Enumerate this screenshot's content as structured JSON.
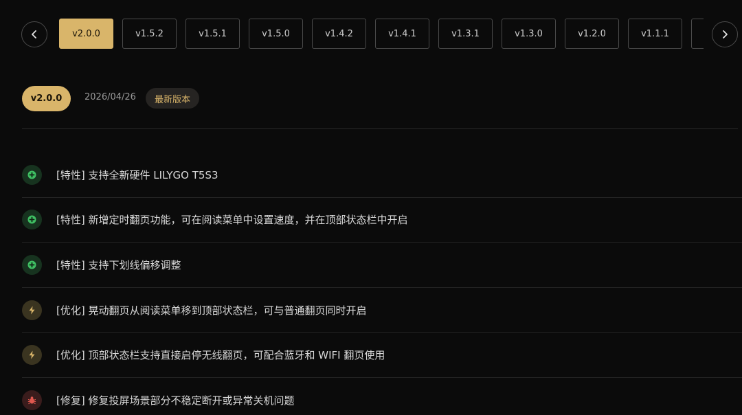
{
  "nav": {
    "prev_icon": "chevron-left-icon",
    "next_icon": "chevron-right-icon"
  },
  "versions": [
    "v2.0.0",
    "v1.5.2",
    "v1.5.1",
    "v1.5.0",
    "v1.4.2",
    "v1.4.1",
    "v1.3.1",
    "v1.3.0",
    "v1.2.0",
    "v1.1.1",
    ""
  ],
  "selected_version": "v2.0.0",
  "release": {
    "version": "v2.0.0",
    "date": "2026/04/26",
    "badge": "最新版本"
  },
  "changes": [
    {
      "type": "feature",
      "icon": "plus-circle-icon",
      "text": "[特性] 支持全新硬件 LILYGO T5S3"
    },
    {
      "type": "feature",
      "icon": "plus-circle-icon",
      "text": "[特性] 新增定时翻页功能，可在阅读菜单中设置速度，并在顶部状态栏中开启"
    },
    {
      "type": "feature",
      "icon": "plus-circle-icon",
      "text": "[特性] 支持下划线偏移调整"
    },
    {
      "type": "improve",
      "icon": "lightning-icon",
      "text": "[优化] 晃动翻页从阅读菜单移到顶部状态栏，可与普通翻页同时开启"
    },
    {
      "type": "improve",
      "icon": "lightning-icon",
      "text": "[优化] 顶部状态栏支持直接启停无线翻页，可配合蓝牙和 WIFI 翻页使用"
    },
    {
      "type": "fix",
      "icon": "bug-icon",
      "text": "[修复] 修复投屏场景部分不稳定断开或异常关机问题"
    }
  ],
  "colors": {
    "accent": "#d9b56a",
    "background": "#0b0b0b",
    "feature": "#3fbf63",
    "improve": "#d9b56a",
    "fix": "#e0584f"
  }
}
